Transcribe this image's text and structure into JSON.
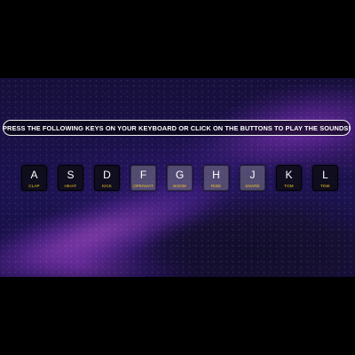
{
  "banner": {
    "text": "PRESS THE FOLLOWING KEYS ON YOUR KEYBOARD OR CLICK ON THE BUTTONS TO PLAY THE SOUNDS!"
  },
  "colors": {
    "key_letter": "#ffffff",
    "sound_label": "#f0c61e",
    "banner_border": "#f2f2f2"
  },
  "keys": [
    {
      "letter": "A",
      "sound": "CLAP"
    },
    {
      "letter": "S",
      "sound": "HIHAT"
    },
    {
      "letter": "D",
      "sound": "KICK"
    },
    {
      "letter": "F",
      "sound": "OPENHAT"
    },
    {
      "letter": "G",
      "sound": "BOOM"
    },
    {
      "letter": "H",
      "sound": "RIDE"
    },
    {
      "letter": "J",
      "sound": "SNARE"
    },
    {
      "letter": "K",
      "sound": "TOM"
    },
    {
      "letter": "L",
      "sound": "TINK"
    }
  ]
}
